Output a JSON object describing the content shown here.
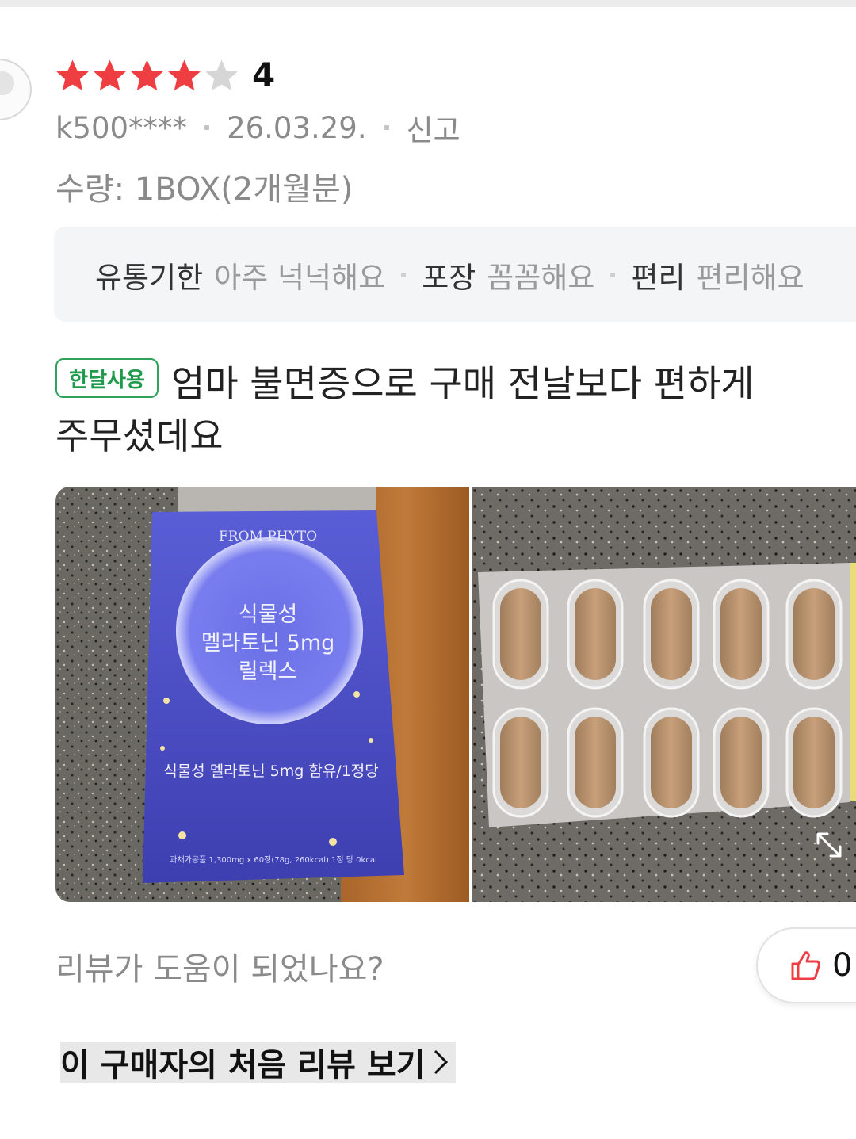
{
  "review": {
    "rating": "4",
    "rating_value": 4,
    "rating_max": 5,
    "star_color": "#ef3e42",
    "star_empty_color": "#d6d6d6",
    "user": "k500****",
    "date": "26.03.29.",
    "report_label": "신고",
    "quantity": "수량: 1BOX(2개월분)",
    "tags": [
      {
        "key": "유통기한",
        "value": "아주 넉넉해요"
      },
      {
        "key": "포장",
        "value": "꼼꼼해요"
      },
      {
        "key": "편리",
        "value": "편리해요"
      }
    ],
    "badge": "한달사용",
    "badge_color": "#2fa35a",
    "text_line1": "엄마 불면증으로 구매 전날보다 편하게",
    "text_line2": "주무셨데요",
    "photos": {
      "left": {
        "brand": "FROM PHYTO",
        "product_line1": "식물성",
        "product_line2": "멜라토닌 5mg",
        "product_line3": "릴렉스",
        "sub_text": "식물성 멜라토닌 5mg 함유/1정당",
        "fine_print": "과채가공품 1,300mg x 60정(78g, 260kcal) 1정 당 0kcal"
      },
      "right": {
        "icon": "expand-icon"
      }
    },
    "helpful_question": "리뷰가 도움이 되었나요?",
    "like_icon": "thumbs-up-icon",
    "like_count": "0",
    "like_color": "#ef3e42",
    "first_review_link": "이 구매자의 처음 리뷰 보기"
  }
}
